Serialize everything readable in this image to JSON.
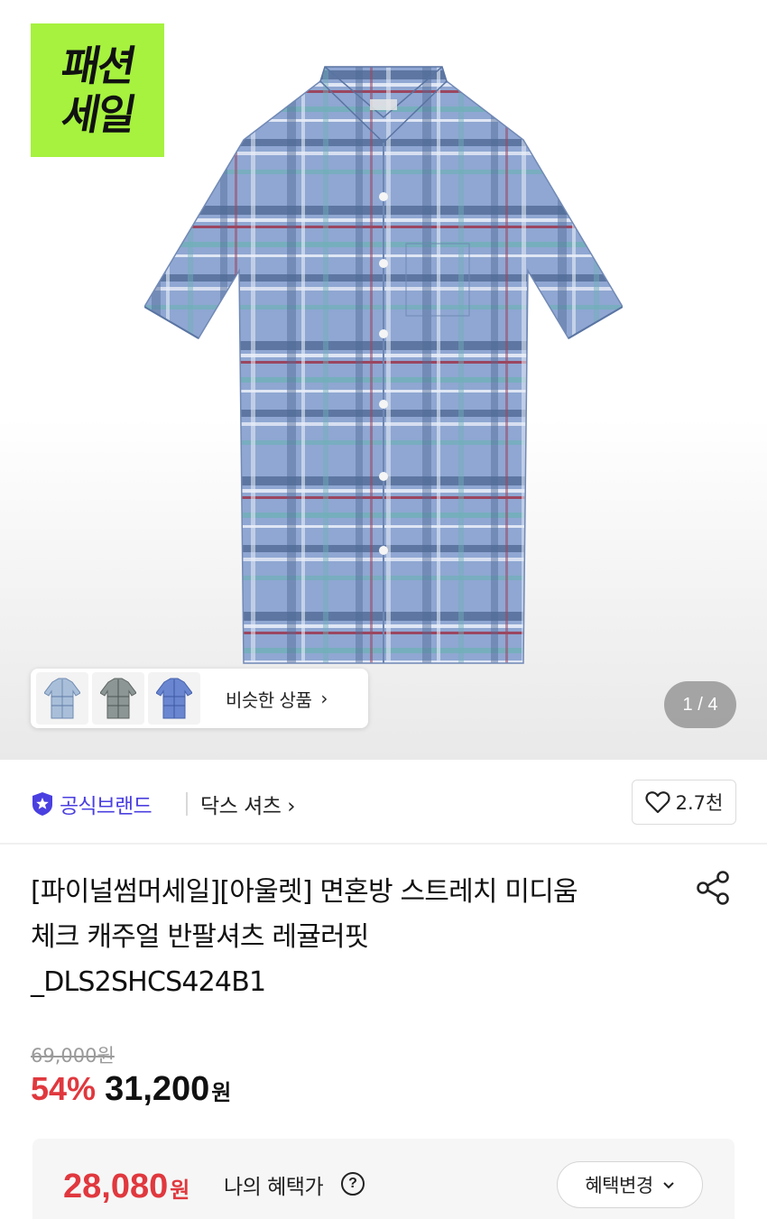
{
  "hero": {
    "sale_badge": [
      "패션",
      "세일"
    ],
    "pager": "1 / 4",
    "similar": {
      "label": "비슷한 상품",
      "arrow": "›",
      "thumbnail_count": 3
    }
  },
  "brand": {
    "official_label": "공식브랜드",
    "official_icon": "star-badge-icon",
    "name": "닥스 셔츠 ›",
    "like_count": "2.7천",
    "like_icon": "heart-icon",
    "accent_color": "#4a3fe0"
  },
  "product": {
    "title_lines": [
      "[파이널썸머세일][아울렛] 면혼방 스트레치 미디움",
      "체크 캐주얼 반팔셔츠 레귤러핏",
      "_DLS2SHCS424B1"
    ],
    "share_icon": "share-icon"
  },
  "price": {
    "original": "69,000원",
    "discount": "54%",
    "sale": "31,200",
    "currency": "원",
    "discount_color": "#e0383e"
  },
  "benefit": {
    "amount": "28,080",
    "currency": "원",
    "label": "나의 혜택가",
    "help_icon": "?",
    "change_label": "혜택변경",
    "change_chevron": "⌄"
  }
}
